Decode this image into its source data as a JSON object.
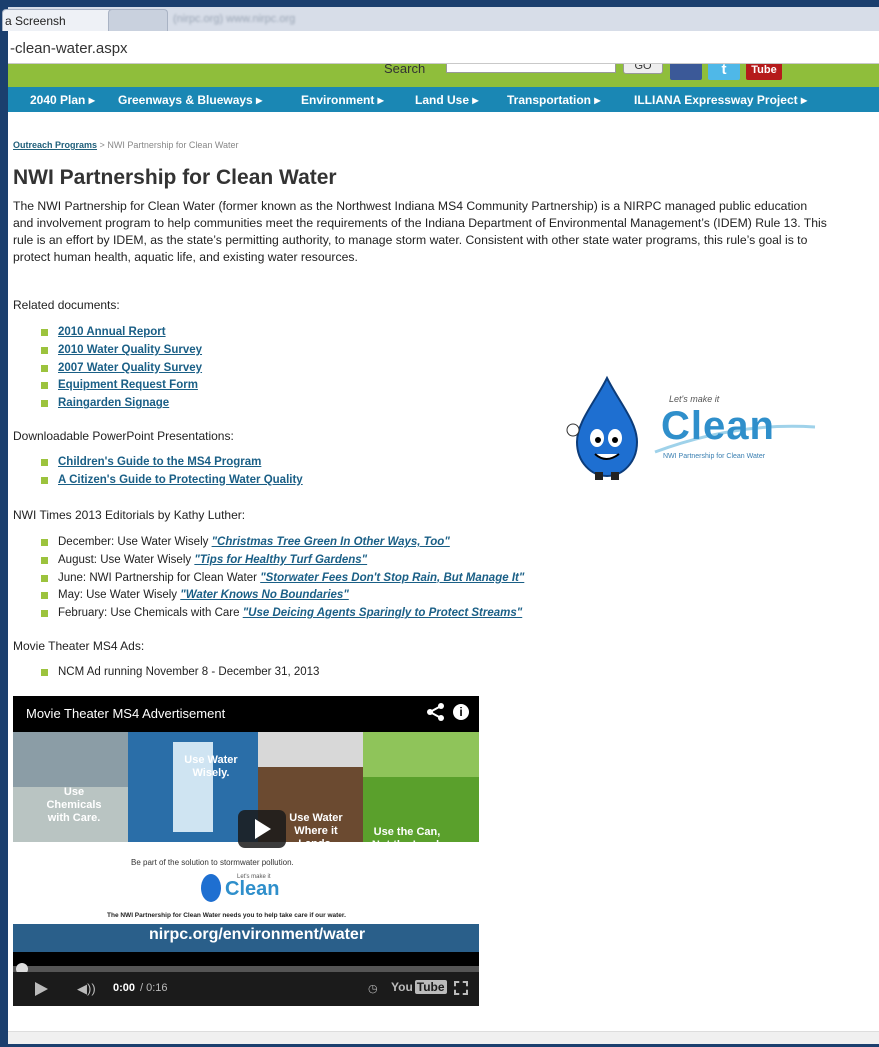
{
  "browser": {
    "tab_active_label": "a Screensh",
    "tab_close": "×",
    "tab_faded_label": "(nirpc.org) www.nirpc.org",
    "address": "-clean-water.aspx"
  },
  "header": {
    "search_label": "Search",
    "go_label": "GO",
    "twitter_glyph": "t",
    "youtube_label": "Tube"
  },
  "nav": {
    "items": [
      {
        "label": "2040 Plan ▸"
      },
      {
        "label": "Greenways & Blueways ▸"
      },
      {
        "label": "Environment ▸"
      },
      {
        "label": "Land Use ▸"
      },
      {
        "label": "Transportation ▸"
      },
      {
        "label": "ILLIANA Expressway Project ▸"
      }
    ]
  },
  "breadcrumb": {
    "parent": "Outreach Programs",
    "separator": ">",
    "current": "NWI Partnership for Clean Water"
  },
  "title": "NWI Partnership for Clean Water",
  "intro": "The NWI Partnership for Clean Water (former known as the Northwest Indiana MS4 Community Partnership) is a NIRPC managed public education and involvement program to help communities meet the requirements of the Indiana Department of Environmental Management’s (IDEM) Rule 13. This rule is an effort by IDEM, as the state’s permitting authority, to manage storm water. Consistent with other state water programs, this rule’s goal is to protect human health, aquatic life, and existing water resources.",
  "related": {
    "label": "Related documents:",
    "links": [
      "2010 Annual Report",
      "2010 Water Quality Survey",
      "2007 Water Quality Survey",
      "Equipment Request Form",
      "Raingarden Signage"
    ]
  },
  "presentations": {
    "label": "Downloadable PowerPoint Presentations:",
    "links": [
      "Children's Guide to the MS4 Program",
      "A Citizen's Guide to Protecting Water Quality"
    ]
  },
  "editorials": {
    "label": "NWI Times 2013 Editorials by Kathy Luther:",
    "items": [
      {
        "prefix": "December: Use Water Wisely ",
        "link": "\"Christmas Tree Green In Other Ways, Too\""
      },
      {
        "prefix": "August: Use Water Wisely ",
        "link": "\"Tips for Healthy Turf Gardens\""
      },
      {
        "prefix": "June: NWI Partnership for Clean Water ",
        "link": "\"Storwater Fees Don't Stop Rain, But Manage It\""
      },
      {
        "prefix": "May: Use Water Wisely ",
        "link": "\"Water Knows No Boundaries\""
      },
      {
        "prefix": "February: Use Chemicals with Care ",
        "link": "\"Use Deicing Agents Sparingly to Protect Streams\""
      }
    ]
  },
  "ads": {
    "label": "Movie Theater MS4 Ads:",
    "items": [
      "NCM Ad running November 8 - December 31, 2013"
    ]
  },
  "logo": {
    "tagline": "Let's make it",
    "word": "Clean",
    "sub": "NWI Partnership for Clean Water"
  },
  "video": {
    "title": "Movie Theater MS4 Advertisement",
    "info_glyph": "i",
    "panels": {
      "chemicals": "Use Chemicals with Care.",
      "wisely": "Use Water Wisely.",
      "lands": "Use Water Where it Lands.",
      "can": "Use the Can, Not the Land."
    },
    "tagline": "Be part of the solution to stormwater pollution.",
    "logo_tag": "Let's make it",
    "logo_word": "Clean",
    "footnote": "The NWI Partnership for Clean Water needs you to help take care if our water.",
    "url": "nirpc.org/environment/water",
    "progress": 0.0,
    "time_current": "0:00",
    "time_total": "/ 0:16",
    "vol_glyph": "◀))",
    "clock_glyph": "◷",
    "yt_you": "You",
    "yt_tube": "Tube"
  },
  "colors": {
    "nav_bg": "#1a87b4",
    "header_strip": "#8fbe3b",
    "link": "#1a5f86",
    "bullet": "#9cc33d",
    "frame": "#1b3f6e"
  }
}
